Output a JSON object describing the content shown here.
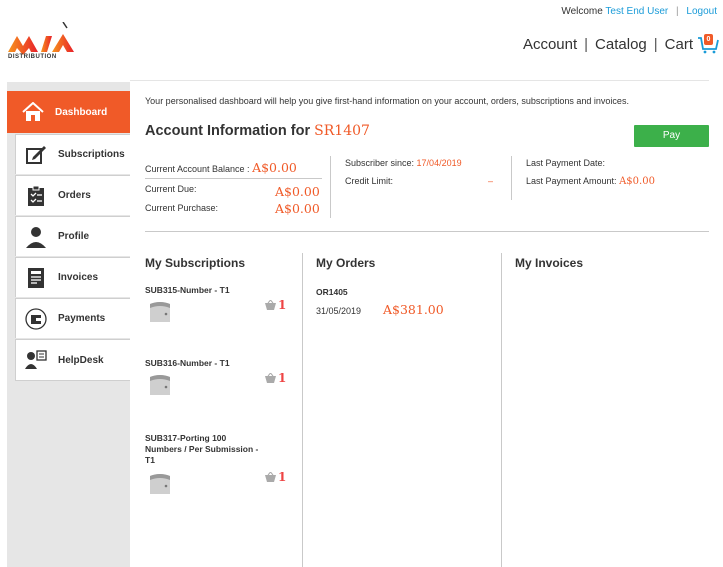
{
  "header": {
    "welcome_prefix": "Welcome",
    "user_name": "Test End User",
    "separator": "|",
    "logout": "Logout",
    "nav": {
      "account": "Account",
      "catalog": "Catalog",
      "cart": "Cart",
      "cart_count": "0"
    },
    "logo_sub": "DISTRIBUTION"
  },
  "sidebar": {
    "items": [
      {
        "label": "Dashboard",
        "icon": "home-icon",
        "active": true
      },
      {
        "label": "Subscriptions",
        "icon": "edit-icon"
      },
      {
        "label": "Orders",
        "icon": "clipboard-icon"
      },
      {
        "label": "Profile",
        "icon": "user-icon"
      },
      {
        "label": "Invoices",
        "icon": "invoice-icon"
      },
      {
        "label": "Payments",
        "icon": "wallet-icon"
      },
      {
        "label": "HelpDesk",
        "icon": "helpdesk-icon"
      }
    ]
  },
  "main": {
    "intro": "Your personalised dashboard will help you give first-hand information on your account, orders, subscriptions and invoices.",
    "title": "Account Information for",
    "account_id": "SR1407",
    "pay": "Pay",
    "balance_label": "Current Account Balance :",
    "balance_value": "A$0.00",
    "due_label": "Current Due:",
    "due_value": "A$0.00",
    "purchase_label": "Current Purchase:",
    "purchase_value": "A$0.00",
    "since_label": "Subscriber since:",
    "since_value": "17/04/2019",
    "credit_label": "Credit Limit:",
    "credit_value": "–",
    "last_date_label": "Last Payment Date:",
    "last_amount_label": "Last Payment Amount:",
    "last_amount_value": "A$0.00"
  },
  "subscriptions": {
    "title": "My Subscriptions",
    "items": [
      {
        "name": "SUB315-Number - T1",
        "qty": "1"
      },
      {
        "name": "SUB316-Number - T1",
        "qty": "1"
      },
      {
        "name": "SUB317-Porting 100 Numbers / Per Submission - T1",
        "qty": "1"
      }
    ]
  },
  "orders": {
    "title": "My Orders",
    "items": [
      {
        "id": "OR1405",
        "date": "31/05/2019",
        "amount": "A$381.00"
      }
    ]
  },
  "invoices": {
    "title": "My Invoices"
  },
  "colors": {
    "accent": "#f05a28",
    "pay": "#3cb04a",
    "link": "#1a9bd8"
  }
}
